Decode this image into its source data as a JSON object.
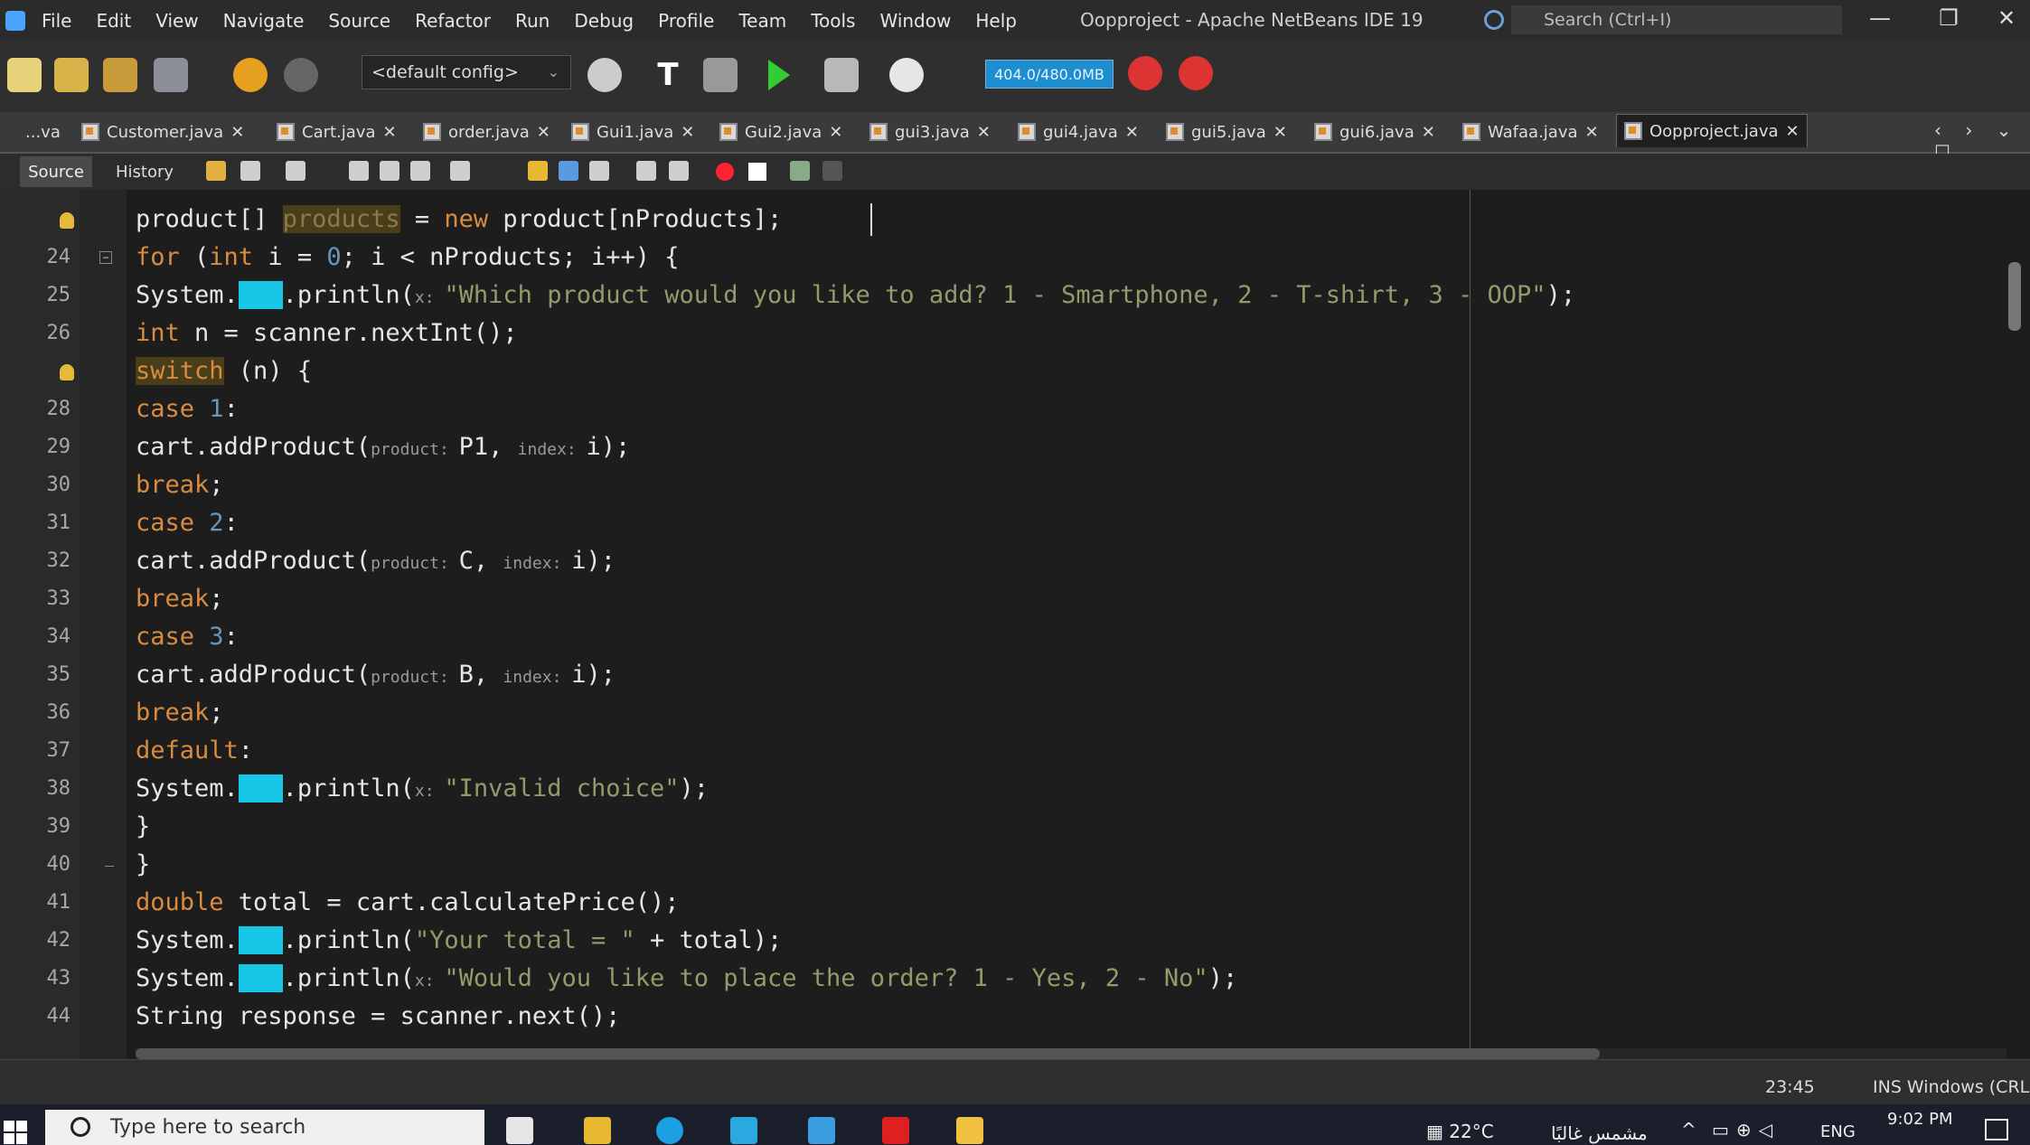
{
  "window": {
    "title": "Oopproject - Apache NetBeans IDE 19",
    "search_placeholder": "Search (Ctrl+I)",
    "controls": [
      "—",
      "❐",
      "✕"
    ]
  },
  "menu": [
    "File",
    "Edit",
    "View",
    "Navigate",
    "Source",
    "Refactor",
    "Run",
    "Debug",
    "Profile",
    "Team",
    "Tools",
    "Window",
    "Help"
  ],
  "toolbar": {
    "config": "<default config>",
    "memory": "404.0/480.0MB"
  },
  "tabs": [
    {
      "label": "...va",
      "close": ""
    },
    {
      "label": "Customer.java",
      "close": "✕"
    },
    {
      "label": "Cart.java",
      "close": "✕"
    },
    {
      "label": "order.java",
      "close": "✕"
    },
    {
      "label": "Gui1.java",
      "close": "✕"
    },
    {
      "label": "Gui2.java",
      "close": "✕"
    },
    {
      "label": "gui3.java",
      "close": "✕"
    },
    {
      "label": "gui4.java",
      "close": "✕"
    },
    {
      "label": "gui5.java",
      "close": "✕"
    },
    {
      "label": "gui6.java",
      "close": "✕"
    },
    {
      "label": "Wafaa.java",
      "close": "✕"
    },
    {
      "label": "Oopproject.java",
      "close": "✕"
    }
  ],
  "tab_nav": "‹ › ⌄ ☐",
  "editor": {
    "source_label": "Source",
    "history_label": "History",
    "lines": [
      {
        "num": "",
        "text": "product[] products = new product[nProducts];"
      },
      {
        "num": "24",
        "text": "for (int i = 0; i < nProducts; i++) {"
      },
      {
        "num": "25",
        "text": "System.out.println(x: \"Which product would you like to add? 1 - Smartphone, 2 - T-shirt, 3 - OOP\");"
      },
      {
        "num": "26",
        "text": "int n = scanner.nextInt();"
      },
      {
        "num": "",
        "text": "switch (n) {"
      },
      {
        "num": "28",
        "text": "case 1:"
      },
      {
        "num": "29",
        "text": "cart.addProduct(product: P1, index: i);"
      },
      {
        "num": "30",
        "text": "break;"
      },
      {
        "num": "31",
        "text": "case 2:"
      },
      {
        "num": "32",
        "text": "cart.addProduct(product: C, index: i);"
      },
      {
        "num": "33",
        "text": "break;"
      },
      {
        "num": "34",
        "text": "case 3:"
      },
      {
        "num": "35",
        "text": "cart.addProduct(product: B, index: i);"
      },
      {
        "num": "36",
        "text": "break;"
      },
      {
        "num": "37",
        "text": "default:"
      },
      {
        "num": "38",
        "text": "System.out.println(x: \"Invalid choice\");"
      },
      {
        "num": "39",
        "text": "}"
      },
      {
        "num": "40",
        "text": "}"
      },
      {
        "num": "41",
        "text": "double total = cart.calculatePrice();"
      },
      {
        "num": "42",
        "text": "System.out.println(\"Your total = \" + total);"
      },
      {
        "num": "43",
        "text": "System.out.println(x: \"Would you like to place the order? 1 - Yes, 2 - No\");"
      },
      {
        "num": "44",
        "text": "String response = scanner.next();"
      }
    ]
  },
  "status": {
    "cursor": "23:45",
    "mode": "INS Windows (CRLF)"
  },
  "taskbar": {
    "search_placeholder": "Type here to search",
    "weather": "22°C",
    "city": "مشمس غالبًا",
    "language": "ENG",
    "time": "9:02 PM"
  },
  "colors": {
    "keyword": "#d98c3f",
    "string": "#8f9d6a",
    "number": "#6897bb",
    "out_highlight": "#18c7e8",
    "memory_bar": "#1d8fd1"
  }
}
